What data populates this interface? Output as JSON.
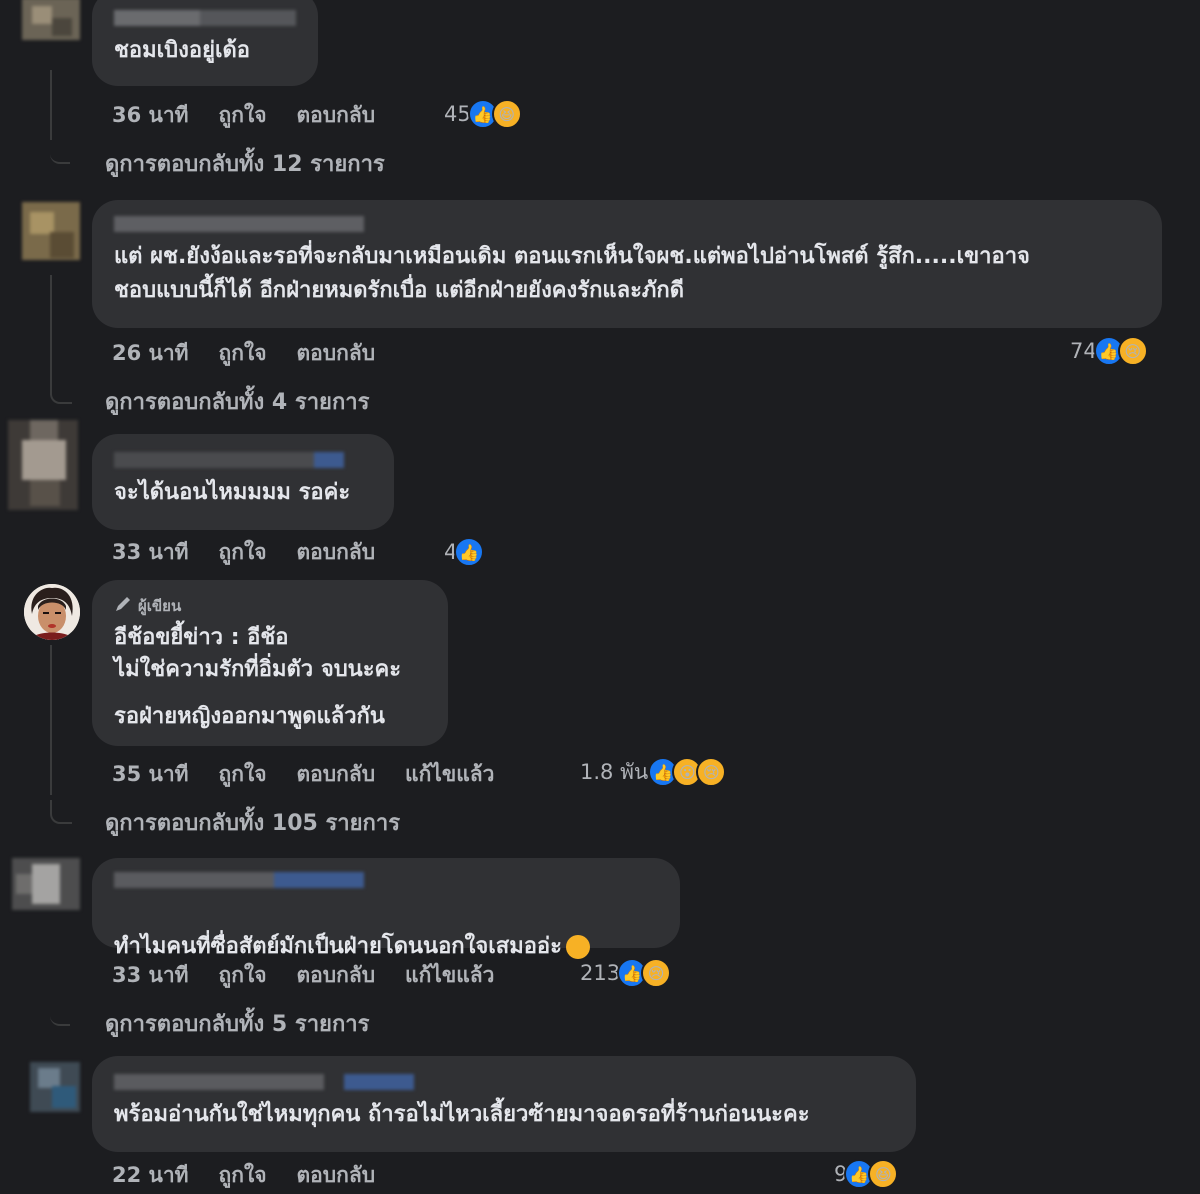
{
  "comments": [
    {
      "id": "c1",
      "text": "ชอมเบิงอยู่เด้อ",
      "time": "36 นาที",
      "like_label": "ถูกใจ",
      "reply_label": "ตอบกลับ",
      "reaction_count": "45",
      "reactions": [
        "like",
        "laugh"
      ],
      "view_replies": "ดูการตอบกลับทั้ง 12 รายการ"
    },
    {
      "id": "c2",
      "text": "แต่ ผช.ยังง้อและรอที่จะกลับมาเหมือนเดิม ตอนแรกเห็นใจผช.แต่พอไปอ่านโพสต์ รู้สึก.....เขาอาจ\nชอบแบบนี้ก็ได้ อีกฝ่ายหมดรักเบื่อ แต่อีกฝ่ายยังคงรักและภักดี",
      "time": "26 นาที",
      "like_label": "ถูกใจ",
      "reply_label": "ตอบกลับ",
      "reaction_count": "74",
      "reactions": [
        "like",
        "sad"
      ],
      "view_replies": "ดูการตอบกลับทั้ง 4 รายการ"
    },
    {
      "id": "c3",
      "text": "จะได้นอนไหมมมม รอค่ะ",
      "time": "33 นาที",
      "like_label": "ถูกใจ",
      "reply_label": "ตอบกลับ",
      "reaction_count": "4",
      "reactions": [
        "like"
      ]
    },
    {
      "id": "c4",
      "author_badge": "ผู้เขียน",
      "text": "อีช้อขยี้ข่าว : อีช้อ\nไม่ใช่ความรักที่อิ่มตัว จบนะคะ",
      "text2": "รอฝ่ายหญิงออกมาพูดแล้วกัน",
      "time": "35 นาที",
      "like_label": "ถูกใจ",
      "reply_label": "ตอบกลับ",
      "edited_label": "แก้ไขแล้ว",
      "reaction_count": "1.8 พัน",
      "reactions": [
        "like",
        "wow",
        "sad"
      ],
      "view_replies": "ดูการตอบกลับทั้ง 105 รายการ"
    },
    {
      "id": "c5",
      "text": "ทำไมคนที่ซื่อสัตย์มักเป็นฝ่ายโดนนอกใจเสมออ่ะ",
      "time": "33 นาที",
      "like_label": "ถูกใจ",
      "reply_label": "ตอบกลับ",
      "edited_label": "แก้ไขแล้ว",
      "reaction_count": "213",
      "reactions": [
        "like",
        "sad"
      ],
      "view_replies": "ดูการตอบกลับทั้ง 5 รายการ"
    },
    {
      "id": "c6",
      "text": "พร้อมอ่านกันใช่ไหมทุกคน ถ้ารอไม่ไหวเลี้ยวซ้ายมาจอดรอที่ร้านก่อนนะคะ",
      "time": "22 นาที",
      "like_label": "ถูกใจ",
      "reply_label": "ตอบกลับ",
      "reaction_count": "9",
      "reactions": [
        "like",
        "laugh"
      ]
    }
  ],
  "colors": {
    "background": "#1c1d20",
    "bubble": "#303134",
    "text": "#e4e6eb",
    "secondary": "#b0b3b8",
    "like": "#1877f2",
    "emoji": "#f7b125"
  }
}
